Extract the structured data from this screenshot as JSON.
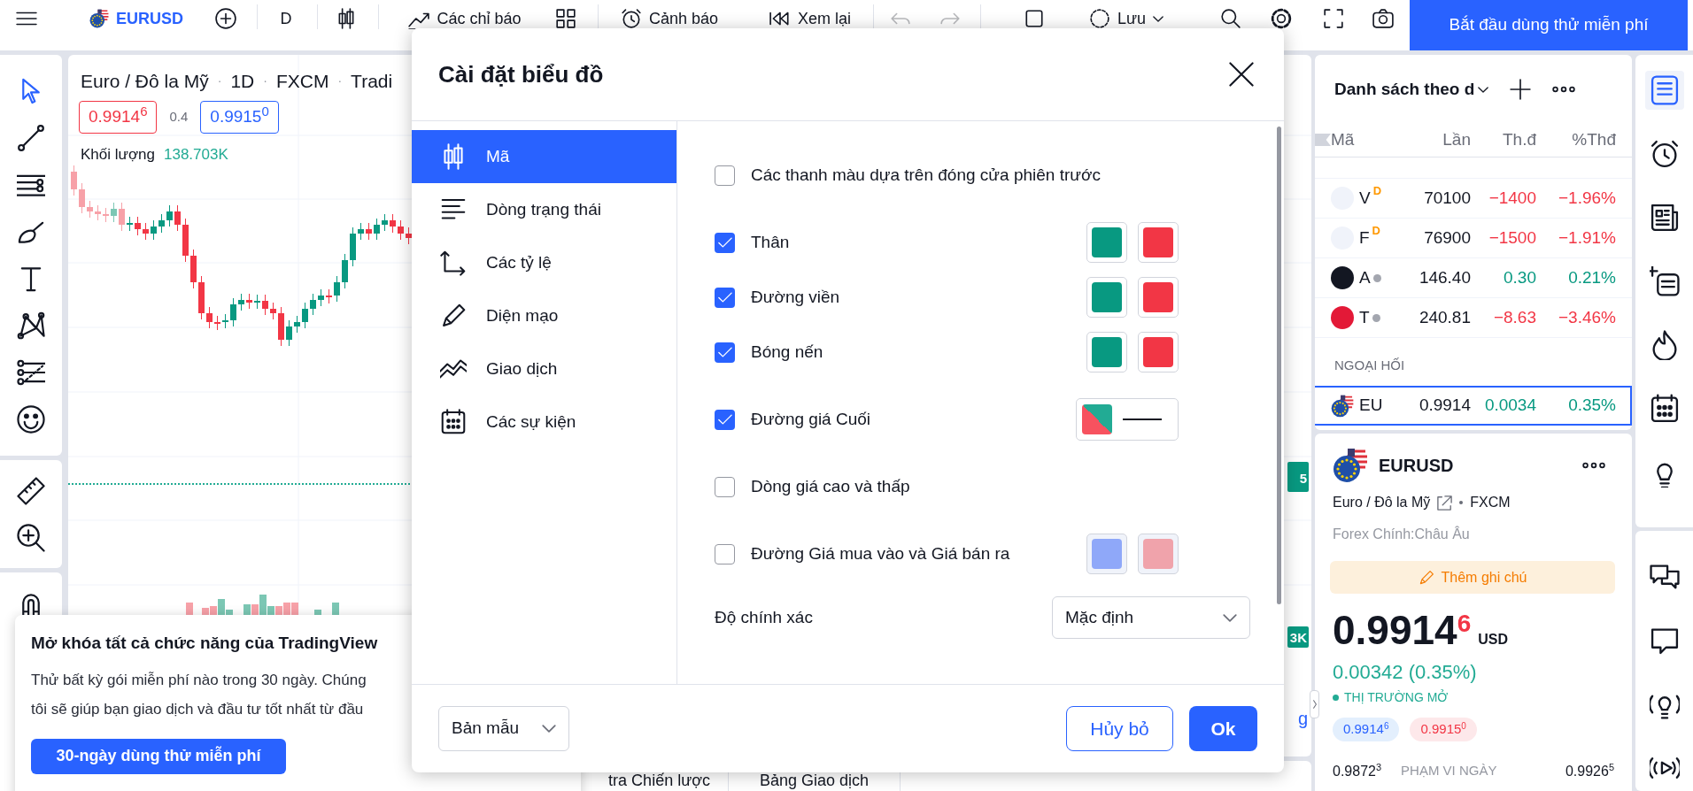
{
  "topbar": {
    "items": [
      {
        "kind": "menu",
        "disabled": false
      },
      {
        "kind": "symbol",
        "label": "EURUSD",
        "disabled": false
      },
      {
        "kind": "add",
        "disabled": false
      },
      {
        "kind": "interval",
        "label": "D",
        "disabled": false
      },
      {
        "kind": "chart_type",
        "disabled": false
      },
      {
        "kind": "indicators",
        "label": "Các chỉ báo",
        "disabled": false
      },
      {
        "kind": "layouts",
        "disabled": false
      },
      {
        "kind": "alert",
        "label": "Cảnh báo",
        "disabled": false
      },
      {
        "kind": "replay",
        "label": "Xem lại",
        "disabled": false
      },
      {
        "kind": "undo",
        "disabled": true
      },
      {
        "kind": "redo",
        "disabled": true
      },
      {
        "kind": "square",
        "disabled": false
      },
      {
        "kind": "save",
        "label": "Lưu",
        "disabled": false
      },
      {
        "kind": "search",
        "disabled": false
      },
      {
        "kind": "settings",
        "disabled": false
      },
      {
        "kind": "fullscreen",
        "disabled": false
      },
      {
        "kind": "snapshot",
        "disabled": false
      },
      {
        "kind": "trial",
        "label": "Bắt đầu dùng thử miễn phí",
        "disabled": false
      }
    ]
  },
  "left_toolbar": {
    "groups": [
      [
        {
          "kind": "cursor",
          "selected": true
        },
        {
          "kind": "trend_line",
          "selected": false
        },
        {
          "kind": "fib",
          "selected": false
        },
        {
          "kind": "brush",
          "selected": false
        },
        {
          "kind": "text",
          "selected": false
        },
        {
          "kind": "pattern",
          "selected": false
        },
        {
          "kind": "prediction",
          "selected": false
        },
        {
          "kind": "smiley",
          "selected": false
        }
      ],
      [
        {
          "kind": "ruler",
          "selected": false
        },
        {
          "kind": "zoom",
          "selected": false
        }
      ],
      [
        {
          "kind": "magnet",
          "selected": false
        }
      ]
    ]
  },
  "chart": {
    "legend": [
      {
        "kind": "label",
        "text": "Euro / Đô la Mỹ"
      },
      {
        "kind": "separator",
        "text": "·"
      },
      {
        "kind": "label",
        "text": "1D"
      },
      {
        "kind": "separator",
        "text": "·"
      },
      {
        "kind": "label",
        "text": "FXCM"
      },
      {
        "kind": "separator",
        "text": "·"
      },
      {
        "kind": "label",
        "text": "Tradi"
      }
    ],
    "bid": "0.9914$^{6}$",
    "spread": "0.4",
    "ask": "0.9915$^{0}$",
    "volume": {
      "label": "Khối lượng",
      "value": "138.703K"
    },
    "axis_tags": [
      {
        "text": "5"
      },
      {
        "text": "3K"
      }
    ],
    "side_link": "g",
    "bottom_tabs": [
      "tra Chiến lược",
      "Bảng Giao dịch"
    ]
  },
  "dialog": {
    "title": "Cài đặt biểu đồ",
    "nav": [
      {
        "kind": "symbol",
        "label": "Mã",
        "selected": true
      },
      {
        "kind": "status_line",
        "label": "Dòng trạng thái",
        "selected": false
      },
      {
        "kind": "scales",
        "label": "Các tỷ lệ",
        "selected": false
      },
      {
        "kind": "appearance",
        "label": "Diện mạo",
        "selected": false
      },
      {
        "kind": "trading",
        "label": "Giao dịch",
        "selected": false
      },
      {
        "kind": "events",
        "label": "Các sự kiện",
        "selected": false
      }
    ],
    "rows": [
      {
        "kind": "checkbox",
        "label": "Các thanh màu dựa trên đóng cửa phiên trước",
        "checked": false
      },
      {
        "kind": "colors",
        "label": "Thân",
        "checked": true,
        "swatches": [
          {
            "color": "#089981"
          },
          {
            "color": "#f23645"
          }
        ]
      },
      {
        "kind": "colors",
        "label": "Đường viền",
        "checked": true,
        "swatches": [
          {
            "color": "#089981"
          },
          {
            "color": "#f23645"
          }
        ]
      },
      {
        "kind": "colors",
        "label": "Bóng nến",
        "checked": true,
        "swatches": [
          {
            "color": "#089981"
          },
          {
            "color": "#f23645"
          }
        ]
      },
      {
        "kind": "line",
        "label": "Đường giá Cuối",
        "checked": true,
        "swatches": [
          {
            "color": "#f7525f"
          },
          {
            "color": "#22ab94"
          }
        ]
      },
      {
        "kind": "checkbox",
        "label": "Dòng giá cao và thấp",
        "checked": false
      },
      {
        "kind": "colors",
        "label": "Đường Giá mua vào và Giá bán ra",
        "checked": false,
        "swatches": [
          {
            "color": "#8fa8f9"
          },
          {
            "color": "#f0a3ab"
          }
        ]
      },
      {
        "kind": "select",
        "label": "Độ chính xác",
        "value": "Mặc định"
      }
    ],
    "template": "Bản mẫu",
    "cancel": "Hủy bỏ",
    "ok": "Ok"
  },
  "watchlist": {
    "title": "Danh sách theo d",
    "columns": [
      "Mã",
      "Lần",
      "Th.đ",
      "%Thđ"
    ],
    "rows": [
      {
        "symbol": "V",
        "badge": "D",
        "last": "70100",
        "change": "−1400",
        "change_pct": "−1.96%",
        "falling": true,
        "color": "#f0f3fa",
        "dot": false,
        "selected": false
      },
      {
        "symbol": "F",
        "badge": "D",
        "last": "76900",
        "change": "−1500",
        "change_pct": "−1.91%",
        "falling": true,
        "color": "#f0f3fa",
        "dot": false,
        "selected": false
      },
      {
        "symbol": "A",
        "last": "146.40",
        "change": "0.30",
        "change_pct": "0.21%",
        "falling": false,
        "color": "#131722",
        "dot": true,
        "selected": false
      },
      {
        "symbol": "T",
        "last": "240.81",
        "change": "−8.63",
        "change_pct": "−3.46%",
        "falling": true,
        "color": "#e31937",
        "dot": true,
        "selected": false
      }
    ],
    "section": "NGOẠI HỐI",
    "section_rows": [
      {
        "symbol": "EU",
        "last": "0.9914",
        "change": "0.0034",
        "change_pct": "0.35%",
        "falling": false,
        "dot": false,
        "selected": true
      }
    ]
  },
  "details": {
    "symbol": "EURUSD",
    "description": "Euro / Đô la Mỹ",
    "exchange": "FXCM",
    "category": "Forex Chính:Châu Âu",
    "note_button": "Thêm ghi chú",
    "price": "0.9914$^{6}$",
    "currency": "USD",
    "change": "0.00342 (0.35%)",
    "market_status": "THỊ TRƯỜNG MỞ",
    "bid": "0.9914$^{6}$",
    "ask": "0.9915$^{0}$",
    "range_low": "0.9872$^{3}$",
    "range_label": "PHẠM VI NGÀY",
    "range_high": "0.9926$^{5}$"
  },
  "right_bar": {
    "groups": [
      [
        {
          "kind": "watchlist",
          "selected": true
        },
        {
          "kind": "alarm",
          "selected": false
        },
        {
          "kind": "news",
          "selected": false
        },
        {
          "kind": "add_list",
          "selected": false
        },
        {
          "kind": "hotlist",
          "selected": false
        },
        {
          "kind": "calendar",
          "selected": false
        },
        {
          "kind": "ideas",
          "selected": false
        }
      ],
      [
        {
          "kind": "chats",
          "selected": false
        },
        {
          "kind": "chat",
          "selected": false
        },
        {
          "kind": "streams",
          "selected": false
        },
        {
          "kind": "broadcast",
          "selected": false
        }
      ]
    ]
  },
  "promo": {
    "title": "Mở khóa tất cả chức năng của TradingView",
    "lines": [
      "Thử bất kỳ gói miễn phí nào trong 30 ngày. Chúng",
      "tôi sẽ giúp bạn giao dịch và đầu tư tốt nhất từ đầu"
    ],
    "button": "30-ngày dùng thử miễn phí"
  }
}
